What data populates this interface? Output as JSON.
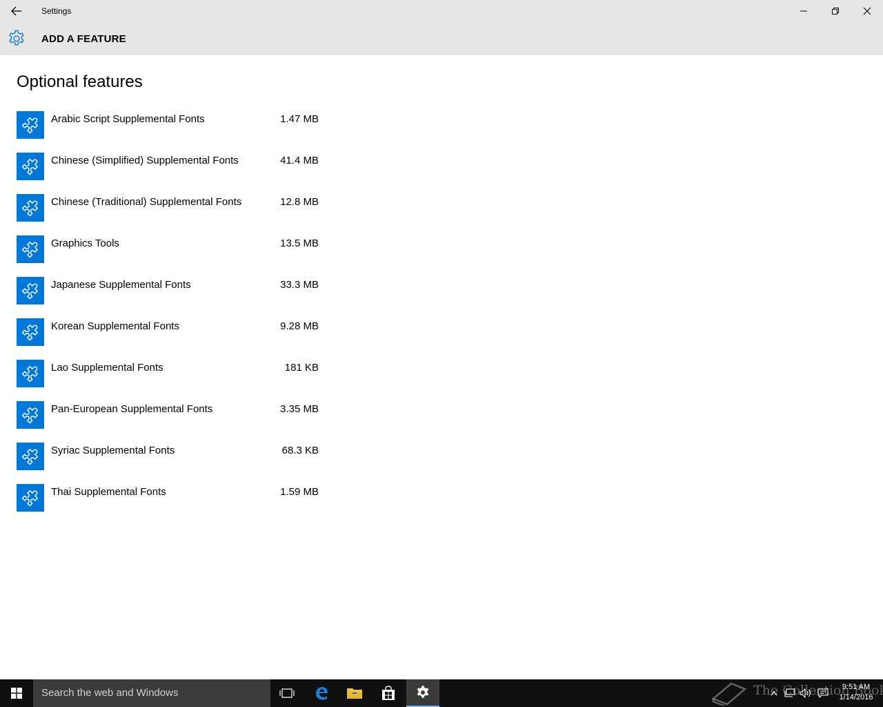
{
  "window": {
    "title": "Settings"
  },
  "header": {
    "title": "ADD A FEATURE"
  },
  "main": {
    "page_title": "Optional features",
    "features": [
      {
        "name": "Arabic Script Supplemental Fonts",
        "size": "1.47 MB"
      },
      {
        "name": "Chinese (Simplified) Supplemental Fonts",
        "size": "41.4 MB"
      },
      {
        "name": "Chinese (Traditional) Supplemental Fonts",
        "size": "12.8 MB"
      },
      {
        "name": "Graphics Tools",
        "size": "13.5 MB"
      },
      {
        "name": "Japanese Supplemental Fonts",
        "size": "33.3 MB"
      },
      {
        "name": "Korean Supplemental Fonts",
        "size": "9.28 MB"
      },
      {
        "name": "Lao Supplemental Fonts",
        "size": "181 KB"
      },
      {
        "name": "Pan-European Supplemental Fonts",
        "size": "3.35 MB"
      },
      {
        "name": "Syriac Supplemental Fonts",
        "size": "68.3 KB"
      },
      {
        "name": "Thai Supplemental Fonts",
        "size": "1.59 MB"
      }
    ]
  },
  "taskbar": {
    "search_placeholder": "Search the web and Windows",
    "time": "9:51 AM",
    "date": "1/14/2016",
    "watermark": "The Collection Book"
  },
  "colors": {
    "accent": "#0078d7",
    "chrome": "#e6e6e6",
    "taskbar": "#101010"
  },
  "icons": {
    "back": "back-arrow-icon",
    "settings": "gear-icon",
    "feature": "puzzle-piece-icon",
    "minimize": "minimize-icon",
    "maximize": "restore-icon",
    "close": "close-icon"
  }
}
